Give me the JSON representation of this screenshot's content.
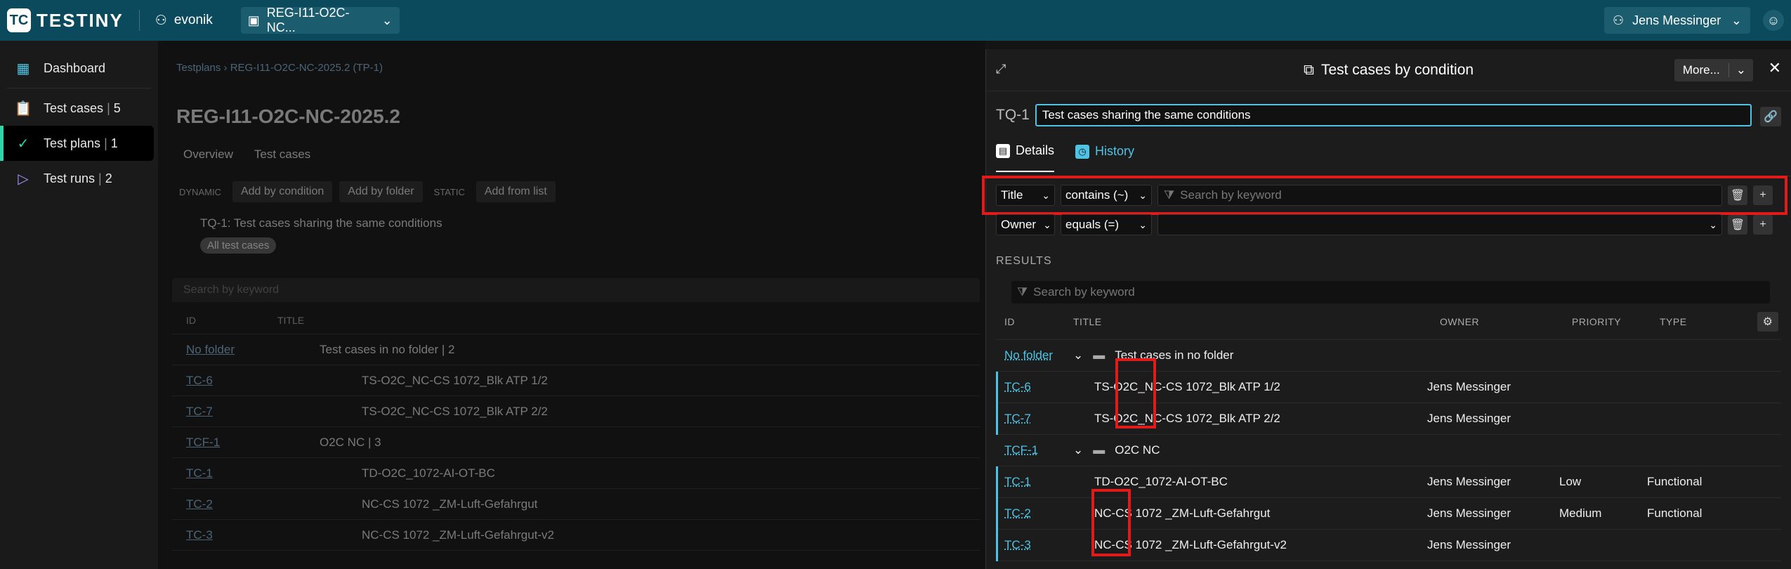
{
  "topbar": {
    "logo_text": "TESTINY",
    "org": "evonik",
    "project": "REG-I11-O2C-NC...",
    "user": "Jens Messinger"
  },
  "sidebar": {
    "items": [
      {
        "label": "Dashboard",
        "count": ""
      },
      {
        "label": "Test cases",
        "count": "5"
      },
      {
        "label": "Test plans",
        "count": "1"
      },
      {
        "label": "Test runs",
        "count": "2"
      }
    ]
  },
  "main": {
    "breadcrumb": "Testplans › REG-I11-O2C-NC-2025.2 (TP-1)",
    "title": "REG-I11-O2C-NC-2025.2",
    "tabs": [
      "Overview",
      "Test cases"
    ],
    "dynamic_label": "DYNAMIC",
    "static_label": "STATIC",
    "actions": [
      "Add by condition",
      "Add by folder",
      "Add from list"
    ],
    "condition": "TQ-1: Test cases sharing the same conditions",
    "chip": "All test cases",
    "search_placeholder": "Search by keyword",
    "col_id": "ID",
    "col_title": "TITLE",
    "rows": [
      {
        "id": "No folder",
        "title": "Test cases in no folder  |  2"
      },
      {
        "id": "TC-6",
        "title": "TS-O2C_NC-CS 1072_Blk ATP 1/2"
      },
      {
        "id": "TC-7",
        "title": "TS-O2C_NC-CS 1072_Blk ATP 2/2"
      },
      {
        "id": "TCF-1",
        "title": "O2C NC  |  3"
      },
      {
        "id": "TC-1",
        "title": "TD-O2C_1072-AI-OT-BC"
      },
      {
        "id": "TC-2",
        "title": "NC-CS 1072 _ZM-Luft-Gefahrgut"
      },
      {
        "id": "TC-3",
        "title": "NC-CS 1072 _ZM-Luft-Gefahrgut-v2"
      }
    ]
  },
  "panel": {
    "title": "Test cases by condition",
    "more_label": "More...",
    "tq_id": "TQ-1",
    "tq_name": "Test cases sharing the same conditions",
    "tabs": {
      "details": "Details",
      "history": "History"
    },
    "filters": [
      {
        "field": "Title",
        "op": "contains  (~)",
        "value_placeholder": "Search by keyword"
      },
      {
        "field": "Owner",
        "op": "equals  (=)",
        "value_placeholder": ""
      }
    ],
    "results_label": "RESULTS",
    "results_search_placeholder": "Search by keyword",
    "columns": {
      "id": "ID",
      "title": "TITLE",
      "owner": "OWNER",
      "priority": "PRIORITY",
      "type": "TYPE"
    },
    "rows": [
      {
        "kind": "folder",
        "id": "No folder",
        "title": "Test cases in no folder",
        "owner": "",
        "priority": "",
        "type": ""
      },
      {
        "kind": "case",
        "id": "TC-6",
        "title": "TS-O2C_NC-CS 1072_Blk ATP 1/2",
        "owner": "Jens Messinger",
        "priority": "",
        "type": ""
      },
      {
        "kind": "case",
        "id": "TC-7",
        "title": "TS-O2C_NC-CS 1072_Blk ATP 2/2",
        "owner": "Jens Messinger",
        "priority": "",
        "type": ""
      },
      {
        "kind": "folder",
        "id": "TCF-1",
        "title": "O2C NC",
        "owner": "",
        "priority": "",
        "type": ""
      },
      {
        "kind": "case",
        "id": "TC-1",
        "title": "TD-O2C_1072-AI-OT-BC",
        "owner": "Jens Messinger",
        "priority": "Low",
        "type": "Functional"
      },
      {
        "kind": "case",
        "id": "TC-2",
        "title": "NC-CS 1072 _ZM-Luft-Gefahrgut",
        "owner": "Jens Messinger",
        "priority": "Medium",
        "type": "Functional"
      },
      {
        "kind": "case",
        "id": "TC-3",
        "title": "NC-CS 1072 _ZM-Luft-Gefahrgut-v2",
        "owner": "Jens Messinger",
        "priority": "",
        "type": ""
      }
    ]
  },
  "colors": {
    "topbar": "#0b4a5c",
    "accent": "#4fc3e3",
    "active_nav": "#2fd4a8",
    "highlight": "#e11a1a"
  }
}
